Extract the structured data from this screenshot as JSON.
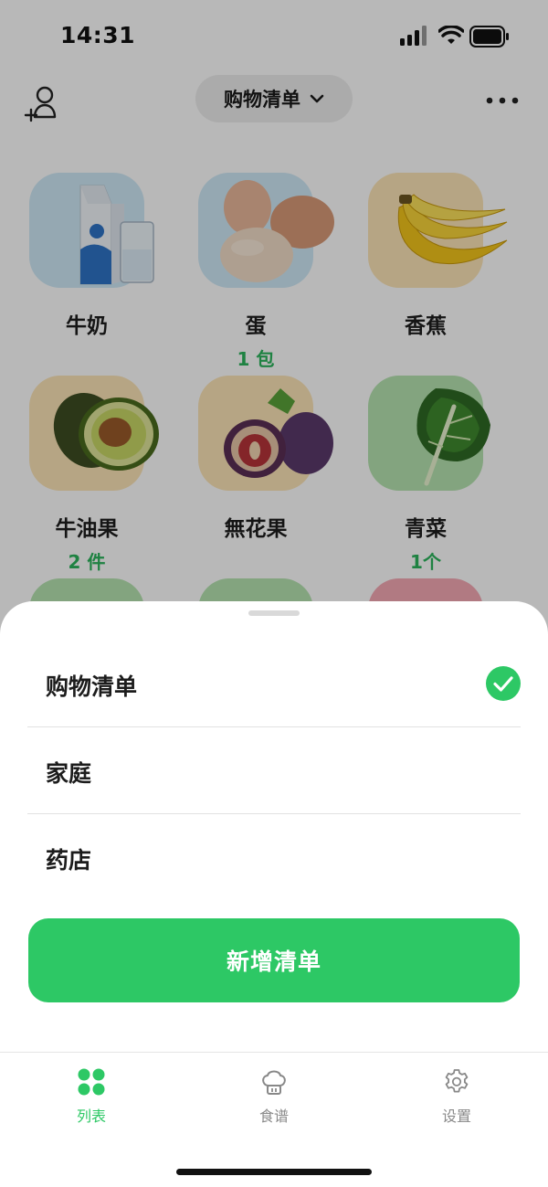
{
  "status_bar": {
    "time": "14:31"
  },
  "header": {
    "list_title": "购物清单"
  },
  "items": [
    {
      "name": "牛奶",
      "qty": "",
      "icon": "milk-carton-icon",
      "tile_color": "#cfe9f7"
    },
    {
      "name": "蛋",
      "qty": "1 包",
      "icon": "eggs-icon",
      "tile_color": "#cfe9f7"
    },
    {
      "name": "香蕉",
      "qty": "",
      "icon": "banana-icon",
      "tile_color": "#fde5b7"
    },
    {
      "name": "牛油果",
      "qty": "2 件",
      "icon": "avocado-icon",
      "tile_color": "#fde5b7"
    },
    {
      "name": "無花果",
      "qty": "",
      "icon": "fig-icon",
      "tile_color": "#fde5b7"
    },
    {
      "name": "青菜",
      "qty": "1个",
      "icon": "greens-icon",
      "tile_color": "#b6e3b1"
    }
  ],
  "sheet": {
    "lists": [
      {
        "label": "购物清单",
        "selected": true
      },
      {
        "label": "家庭",
        "selected": false
      },
      {
        "label": "药店",
        "selected": false
      }
    ],
    "new_list_label": "新增清单"
  },
  "tabs": [
    {
      "label": "列表",
      "icon": "four-dots-icon",
      "active": true
    },
    {
      "label": "食谱",
      "icon": "chef-hat-icon",
      "active": false
    },
    {
      "label": "设置",
      "icon": "gear-icon",
      "active": false
    }
  ],
  "colors": {
    "accent": "#2dc865",
    "qty_text": "#2bb55c"
  }
}
